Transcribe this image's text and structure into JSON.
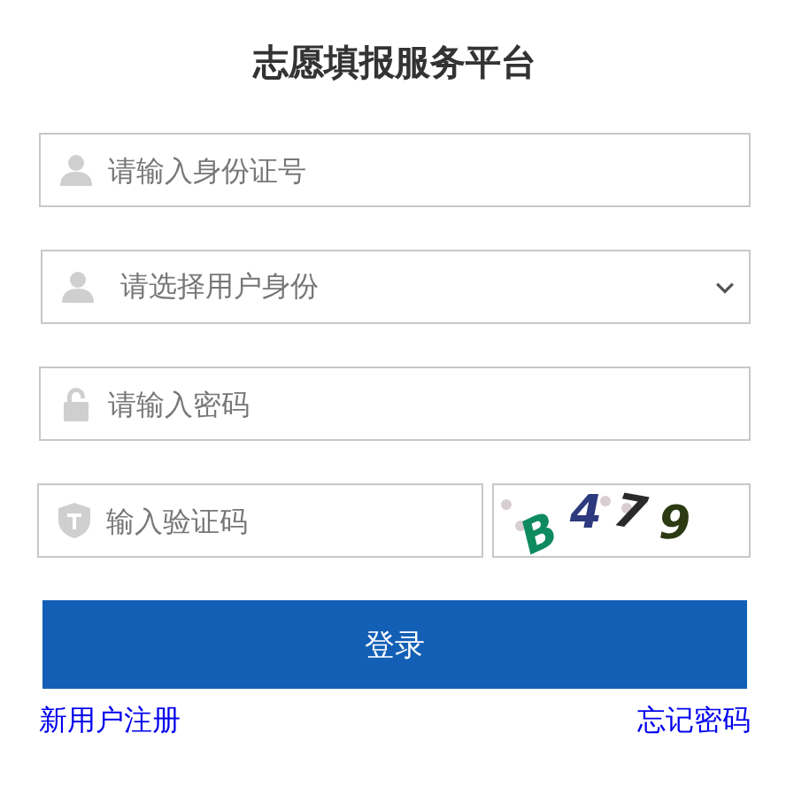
{
  "title": "志愿填报服务平台",
  "id_field": {
    "placeholder": "请输入身份证号"
  },
  "role_select": {
    "placeholder": "请选择用户身份"
  },
  "password_field": {
    "placeholder": "请输入密码"
  },
  "captcha_field": {
    "placeholder": "输入验证码"
  },
  "captcha": {
    "chars": [
      {
        "text": "B",
        "color": "#0e8a5f"
      },
      {
        "text": "4",
        "color": "#2e3a7e"
      },
      {
        "text": "7",
        "color": "#2a2a2a"
      },
      {
        "text": "9",
        "color": "#2c3a14"
      }
    ]
  },
  "login_button": "登录",
  "links": [
    "新用户注册",
    "忘记密码"
  ]
}
